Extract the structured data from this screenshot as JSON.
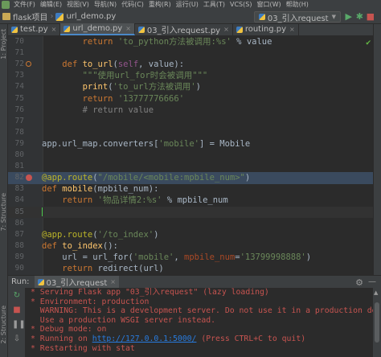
{
  "menu": [
    "文件(F)",
    "编辑(E)",
    "视图(V)",
    "导航(N)",
    "代码(C)",
    "重构(R)",
    "运行(U)",
    "工具(T)",
    "VCS(S)",
    "窗口(W)",
    "帮助(H)"
  ],
  "nav": {
    "project": "flask项目",
    "file": "url_demo.py",
    "run_config": "03_引入request"
  },
  "left_tools": [
    "1: Project",
    "7: Structure",
    "2: Structure"
  ],
  "tabs": [
    {
      "label": "test.py",
      "active": false
    },
    {
      "label": "url_demo.py",
      "active": true
    },
    {
      "label": "03_引入request.py",
      "active": false
    },
    {
      "label": "routing.py",
      "active": false
    }
  ],
  "editor": {
    "lines": [
      {
        "n": "70",
        "html": "        <span class='kw'>return</span> <span class='str'>'to_python方法被调用:%s'</span> % value"
      },
      {
        "n": "71",
        "html": ""
      },
      {
        "n": "72",
        "html": "    <span class='kw'>def</span> <span class='fn'>to_url</span>(<span class='self'>self</span>, value):",
        "marker": "ovr"
      },
      {
        "n": "73",
        "html": "        <span class='str'>\"\"\"使用url_for时会被调用\"\"\"</span>"
      },
      {
        "n": "74",
        "html": "        <span class='fn'>print</span>(<span class='str'>'to_url方法被调用'</span>)"
      },
      {
        "n": "75",
        "html": "        <span class='kw'>return</span> <span class='str'>'13777776666'</span>"
      },
      {
        "n": "76",
        "html": "        <span class='cm'># return value</span>"
      },
      {
        "n": "77",
        "html": ""
      },
      {
        "n": "78",
        "html": ""
      },
      {
        "n": "79",
        "html": "app.url_map.converters[<span class='str'>'mobile'</span>] = Mobile"
      },
      {
        "n": "80",
        "html": ""
      },
      {
        "n": "81",
        "html": ""
      },
      {
        "n": "82",
        "html": "<span class='deco'>@app.route</span>(<span class='str'>\"/mobile/&lt;mobile:mpbile_num&gt;\"</span>)",
        "marker": "bp"
      },
      {
        "n": "83",
        "html": "<span class='kw'>def</span> <span class='fn'>mobile</span>(mpbile_num):"
      },
      {
        "n": "84",
        "html": "    <span class='kw'>return</span> <span class='str'>'物品详情2:%s'</span> % mpbile_num"
      },
      {
        "n": "85",
        "html": "<span class='caret'></span>",
        "current": true
      },
      {
        "n": "86",
        "html": ""
      },
      {
        "n": "87",
        "html": "<span class='deco'>@app.route</span>(<span class='str'>'/to_index'</span>)"
      },
      {
        "n": "88",
        "html": "<span class='kw'>def</span> <span class='fn'>to_index</span>():"
      },
      {
        "n": "89",
        "html": "    url = url_for(<span class='str'>'mobile'</span>, <span class='prm'>mpbile_num</span>=<span class='str'>'13799998888'</span>)"
      },
      {
        "n": "90",
        "html": "    <span class='kw'>return</span> redirect(url)"
      }
    ]
  },
  "run": {
    "label": "Run:",
    "tab": "03_引入request",
    "console": [
      "* Serving Flask app \"03_引入request\" (lazy loading)",
      "* Environment: production",
      "  WARNING: This is a development server. Do not use it in a production deployme",
      "  Use a production WSGI server instead.",
      "* Debug mode: on",
      "* Running on <a>http://127.0.0.1:5000/</a> (Press CTRL+C to quit)",
      "* Restarting with stat"
    ]
  },
  "colors": {
    "editor_bg": "#2b2b2b",
    "keyword": "#cc7832",
    "string": "#6a8759",
    "function": "#ffc66d",
    "console_text": "#c75450"
  }
}
